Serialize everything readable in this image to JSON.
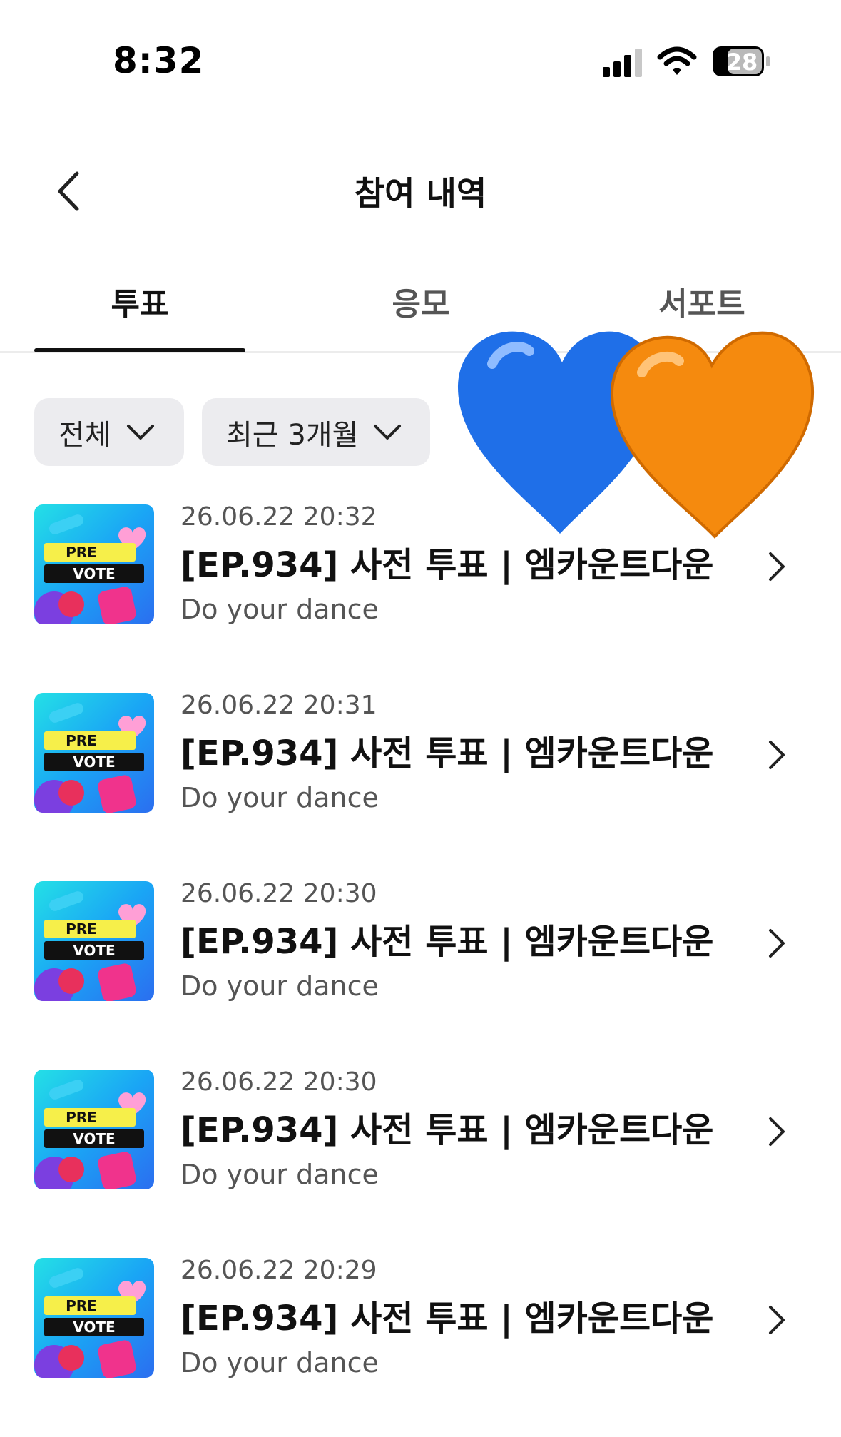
{
  "status_bar": {
    "time": "8:32",
    "battery": "28"
  },
  "header": {
    "title": "참여 내역"
  },
  "tabs": [
    {
      "label": "투표",
      "active": true
    },
    {
      "label": "응모",
      "active": false
    },
    {
      "label": "서포트",
      "active": false
    }
  ],
  "filters": [
    {
      "label": "전체"
    },
    {
      "label": "최근 3개월"
    }
  ],
  "thumb": {
    "line1": "PRE",
    "line2": "VOTE"
  },
  "items": [
    {
      "date": "26.06.22 20:32",
      "title": "[EP.934] 사전 투표 | 엠카운트다운",
      "subtitle": "Do your dance"
    },
    {
      "date": "26.06.22 20:31",
      "title": "[EP.934] 사전 투표 | 엠카운트다운",
      "subtitle": "Do your dance"
    },
    {
      "date": "26.06.22 20:30",
      "title": "[EP.934] 사전 투표 | 엠카운트다운",
      "subtitle": "Do your dance"
    },
    {
      "date": "26.06.22 20:30",
      "title": "[EP.934] 사전 투표 | 엠카운트다운",
      "subtitle": "Do your dance"
    },
    {
      "date": "26.06.22 20:29",
      "title": "[EP.934] 사전 투표 | 엠카운트다운",
      "subtitle": "Do your dance"
    }
  ],
  "colors": {
    "heart_blue": "#1f6fe8",
    "heart_orange": "#f58a0e",
    "active_tab": "#111111",
    "filter_bg": "#ececef"
  }
}
